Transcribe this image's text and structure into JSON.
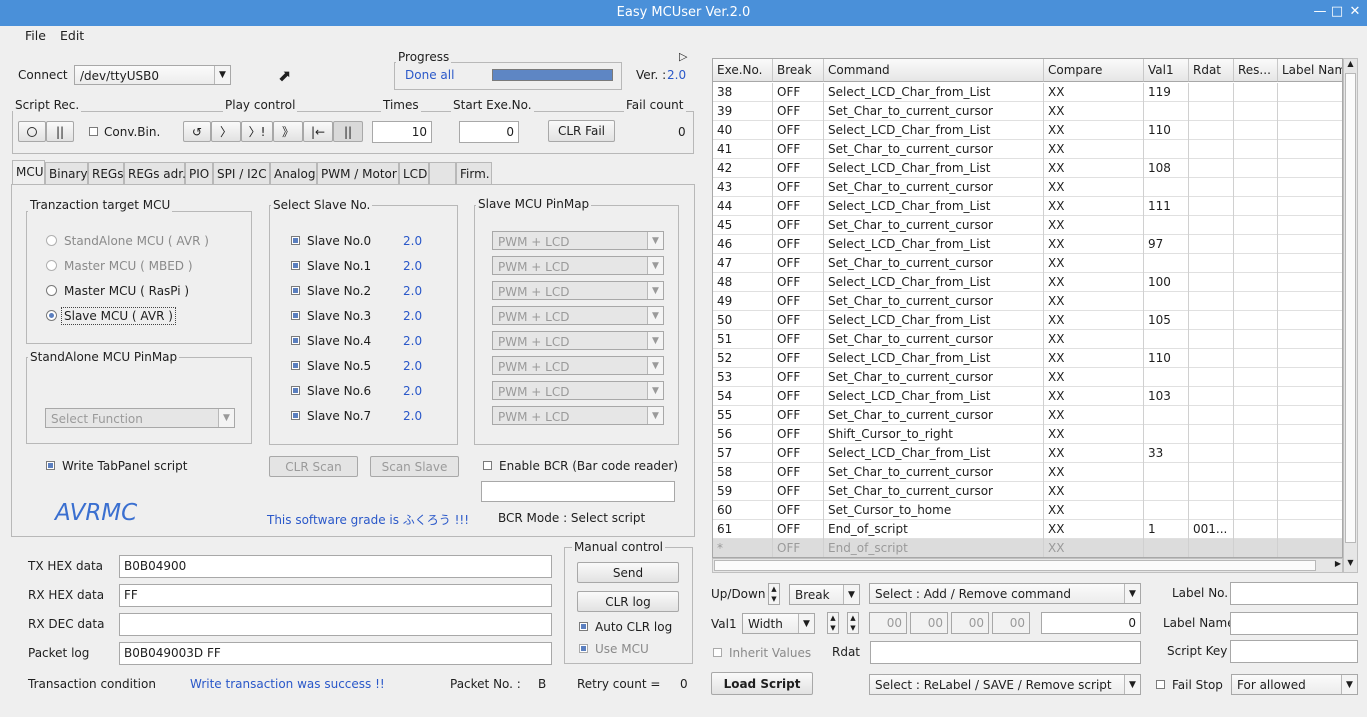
{
  "window": {
    "title": "Easy MCUser Ver.2.0"
  },
  "menu": {
    "file": "File",
    "edit": "Edit"
  },
  "connect": {
    "label": "Connect",
    "port": "/dev/ttyUSB0"
  },
  "progress": {
    "label": "Progress",
    "status": "Done all",
    "value_percent": 100
  },
  "version": {
    "label": "Ver. :",
    "value": "2.0"
  },
  "script_rec": {
    "label": "Script Rec.",
    "conv_bin": "Conv.Bin."
  },
  "play_control": {
    "label": "Play control",
    "buttons": [
      "↺",
      "〉",
      "〉!",
      "》",
      "|←",
      "||"
    ]
  },
  "times": {
    "label": "Times",
    "value": "10"
  },
  "start_exe": {
    "label": "Start Exe.No.",
    "value": "0"
  },
  "fail": {
    "label": "Fail count",
    "value": "0",
    "clr_button": "CLR Fail"
  },
  "tabs": [
    "MCU",
    "Binary",
    "REGs",
    "REGs adr.",
    "PIO",
    "SPI / I2C",
    "Analog",
    "PWM / Motor",
    "LCD",
    "",
    "Firm."
  ],
  "target_mcu": {
    "label": "Tranzaction target MCU",
    "options": [
      "StandAlone MCU ( AVR )",
      "Master MCU ( MBED )",
      "Master MCU ( RasPi )",
      "Slave MCU ( AVR )"
    ]
  },
  "standalone_pinmap": {
    "label": "StandAlone MCU PinMap",
    "select": "Select Function"
  },
  "write_tabpanel": "Write TabPanel script",
  "brand": "AVRMC",
  "slaves": {
    "label": "Select Slave No.",
    "items": [
      {
        "name": "Slave No.0",
        "ver": "2.0"
      },
      {
        "name": "Slave No.1",
        "ver": "2.0"
      },
      {
        "name": "Slave No.2",
        "ver": "2.0"
      },
      {
        "name": "Slave No.3",
        "ver": "2.0"
      },
      {
        "name": "Slave No.4",
        "ver": "2.0"
      },
      {
        "name": "Slave No.5",
        "ver": "2.0"
      },
      {
        "name": "Slave No.6",
        "ver": "2.0"
      },
      {
        "name": "Slave No.7",
        "ver": "2.0"
      }
    ],
    "clr_scan": "CLR Scan",
    "scan_slave": "Scan Slave"
  },
  "slave_pinmap": {
    "label": "Slave MCU PinMap",
    "option": "PWM + LCD"
  },
  "grade": "This software grade is ふくろう !!!",
  "bcr": {
    "enable": "Enable BCR (Bar code reader)",
    "mode": "BCR Mode : Select script"
  },
  "tx_hex": {
    "label": "TX HEX data",
    "value": "B0B04900"
  },
  "rx_hex": {
    "label": "RX HEX data",
    "value": "FF"
  },
  "rx_dec": {
    "label": "RX DEC data",
    "value": ""
  },
  "packet_log": {
    "label": "Packet log",
    "value": "B0B049003D FF"
  },
  "transaction": {
    "label": "Transaction condition",
    "value": "Write transaction was success !!"
  },
  "packet_no": {
    "label": "Packet No. :",
    "value": "B"
  },
  "retry": {
    "label": "Retry count  =",
    "value": "0"
  },
  "manual": {
    "label": "Manual control",
    "send": "Send",
    "clr_log": "CLR log",
    "auto_clr": "Auto CLR log",
    "use_mcu": "Use MCU"
  },
  "grid": {
    "headers": [
      "Exe.No.",
      "Break",
      "Command",
      "Compare",
      "Val1",
      "Rdat",
      "Res...",
      "Label Name"
    ],
    "rows": [
      [
        "38",
        "OFF",
        "Select_LCD_Char_from_List",
        "XX",
        "119",
        "",
        "",
        ""
      ],
      [
        "39",
        "OFF",
        "Set_Char_to_current_cursor",
        "XX",
        "",
        "",
        "",
        ""
      ],
      [
        "40",
        "OFF",
        "Select_LCD_Char_from_List",
        "XX",
        "110",
        "",
        "",
        ""
      ],
      [
        "41",
        "OFF",
        "Set_Char_to_current_cursor",
        "XX",
        "",
        "",
        "",
        ""
      ],
      [
        "42",
        "OFF",
        "Select_LCD_Char_from_List",
        "XX",
        "108",
        "",
        "",
        ""
      ],
      [
        "43",
        "OFF",
        "Set_Char_to_current_cursor",
        "XX",
        "",
        "",
        "",
        ""
      ],
      [
        "44",
        "OFF",
        "Select_LCD_Char_from_List",
        "XX",
        "111",
        "",
        "",
        ""
      ],
      [
        "45",
        "OFF",
        "Set_Char_to_current_cursor",
        "XX",
        "",
        "",
        "",
        ""
      ],
      [
        "46",
        "OFF",
        "Select_LCD_Char_from_List",
        "XX",
        "97",
        "",
        "",
        ""
      ],
      [
        "47",
        "OFF",
        "Set_Char_to_current_cursor",
        "XX",
        "",
        "",
        "",
        ""
      ],
      [
        "48",
        "OFF",
        "Select_LCD_Char_from_List",
        "XX",
        "100",
        "",
        "",
        ""
      ],
      [
        "49",
        "OFF",
        "Set_Char_to_current_cursor",
        "XX",
        "",
        "",
        "",
        ""
      ],
      [
        "50",
        "OFF",
        "Select_LCD_Char_from_List",
        "XX",
        "105",
        "",
        "",
        ""
      ],
      [
        "51",
        "OFF",
        "Set_Char_to_current_cursor",
        "XX",
        "",
        "",
        "",
        ""
      ],
      [
        "52",
        "OFF",
        "Select_LCD_Char_from_List",
        "XX",
        "110",
        "",
        "",
        ""
      ],
      [
        "53",
        "OFF",
        "Set_Char_to_current_cursor",
        "XX",
        "",
        "",
        "",
        ""
      ],
      [
        "54",
        "OFF",
        "Select_LCD_Char_from_List",
        "XX",
        "103",
        "",
        "",
        ""
      ],
      [
        "55",
        "OFF",
        "Set_Char_to_current_cursor",
        "XX",
        "",
        "",
        "",
        ""
      ],
      [
        "56",
        "OFF",
        "Shift_Cursor_to_right",
        "XX",
        "",
        "",
        "",
        ""
      ],
      [
        "57",
        "OFF",
        "Select_LCD_Char_from_List",
        "XX",
        "33",
        "",
        "",
        ""
      ],
      [
        "58",
        "OFF",
        "Set_Char_to_current_cursor",
        "XX",
        "",
        "",
        "",
        ""
      ],
      [
        "59",
        "OFF",
        "Set_Char_to_current_cursor",
        "XX",
        "",
        "",
        "",
        ""
      ],
      [
        "60",
        "OFF",
        "Set_Cursor_to_home",
        "XX",
        "",
        "",
        "",
        ""
      ],
      [
        "61",
        "OFF",
        "End_of_script",
        "XX",
        "1",
        "001...",
        "",
        ""
      ],
      [
        "*",
        "OFF",
        "End_of_script",
        "XX",
        "",
        "",
        "",
        ""
      ]
    ]
  },
  "bottom": {
    "updown": "Up/Down",
    "break_sel": "Break",
    "command_sel": "Select : Add / Remove command",
    "label_no": "Label No.",
    "val1": "Val1",
    "width_sel": "Width",
    "hex_fields": [
      "00",
      "00",
      "00",
      "00"
    ],
    "val_value": "0",
    "label_name": "Label Name",
    "inherit": "Inherit Values",
    "rdat": "Rdat",
    "script_key": "Script Key",
    "load_script": "Load Script",
    "relabel_sel": "Select : ReLabel / SAVE / Remove script",
    "fail_stop": "Fail Stop",
    "allowed_sel": "For allowed"
  }
}
